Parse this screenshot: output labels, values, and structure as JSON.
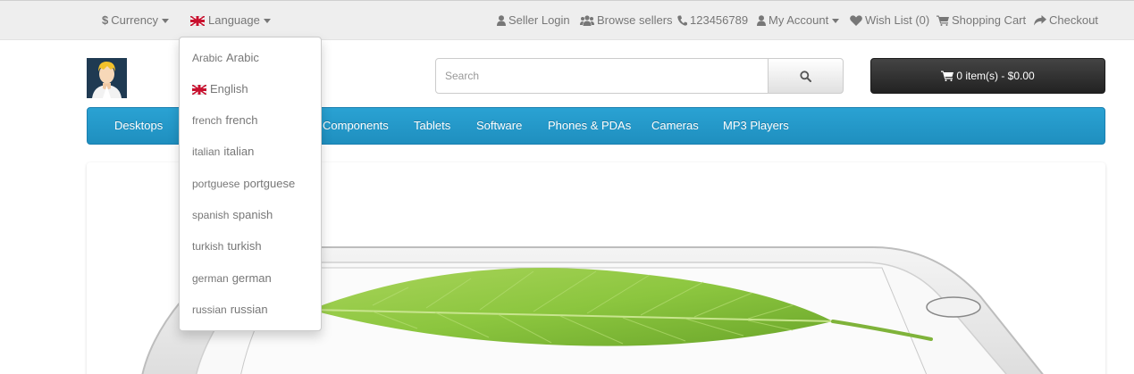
{
  "top_bar": {
    "currency": {
      "symbol": "$",
      "label": "Currency"
    },
    "language": {
      "label": "Language"
    },
    "seller_login": "Seller Login",
    "browse_sellers": "Browse sellers",
    "phone": "123456789",
    "my_account": "My Account",
    "wish_list": "Wish List (0)",
    "shopping_cart": "Shopping Cart",
    "checkout": "Checkout"
  },
  "search": {
    "placeholder": "Search"
  },
  "cart": {
    "label": "0 item(s) - $0.00"
  },
  "menu": {
    "items": [
      "Desktops",
      "Components",
      "Tablets",
      "Software",
      "Phones & PDAs",
      "Cameras",
      "MP3 Players"
    ]
  },
  "language_dropdown": {
    "items": [
      {
        "prefix": "Arabic",
        "name": "Arabic",
        "flag": false
      },
      {
        "prefix": "",
        "name": "English",
        "flag": true
      },
      {
        "prefix": "french",
        "name": "french",
        "flag": false
      },
      {
        "prefix": "italian",
        "name": "italian",
        "flag": false
      },
      {
        "prefix": "portguese",
        "name": "portguese",
        "flag": false
      },
      {
        "prefix": "spanish",
        "name": "spanish",
        "flag": false
      },
      {
        "prefix": "turkish",
        "name": "turkish",
        "flag": false
      },
      {
        "prefix": "german",
        "name": "german",
        "flag": false
      },
      {
        "prefix": "russian",
        "name": "russian",
        "flag": false
      }
    ]
  },
  "colors": {
    "menu_bar": "#229ac8",
    "cart_button": "#303030",
    "top_bar": "#eeeeee",
    "leaf_green": "#8cc63f"
  }
}
